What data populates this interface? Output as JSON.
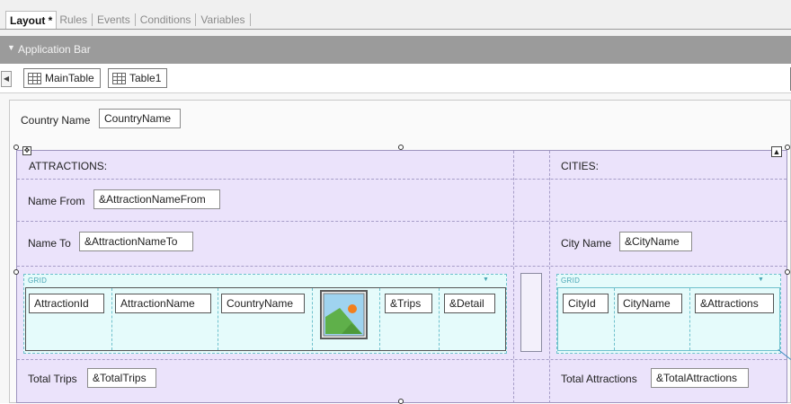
{
  "tabs": [
    {
      "label": "Layout *",
      "active": true
    },
    {
      "label": "Rules",
      "active": false
    },
    {
      "label": "Events",
      "active": false
    },
    {
      "label": "Conditions",
      "active": false
    },
    {
      "label": "Variables",
      "active": false
    }
  ],
  "app_bar": {
    "label": "Application Bar",
    "icon": "chevron-down-icon"
  },
  "breadcrumb": {
    "items": [
      {
        "label": "MainTable",
        "icon": "table-icon"
      },
      {
        "label": "Table1",
        "icon": "table-icon"
      }
    ],
    "back_icon": "caret-left-icon"
  },
  "form": {
    "country_label": "Country Name",
    "country_value": "CountryName"
  },
  "attractions": {
    "header": "ATTRACTIONS:",
    "name_from_label": "Name From",
    "name_from_value": "&AttractionNameFrom",
    "name_to_label": "Name To",
    "name_to_value": "&AttractionNameTo",
    "grid_title": "GRID",
    "grid_columns": [
      "AttractionId",
      "AttractionName",
      "CountryName",
      "",
      "&Trips",
      "&Detail"
    ],
    "image_icon": "image-placeholder-icon",
    "total_label": "Total Trips",
    "total_value": "&TotalTrips"
  },
  "cities": {
    "header": "CITIES:",
    "city_name_label": "City Name",
    "city_name_value": "&CityName",
    "grid_title": "GRID",
    "grid_columns": [
      "CityId",
      "CityName",
      "&Attractions"
    ],
    "total_label": "Total Attractions",
    "total_value": "&TotalAttractions"
  },
  "colors": {
    "table_bg": "#ebe3fb",
    "grid_bg": "#e5fbfb",
    "app_bar": "#9b9b9b"
  }
}
